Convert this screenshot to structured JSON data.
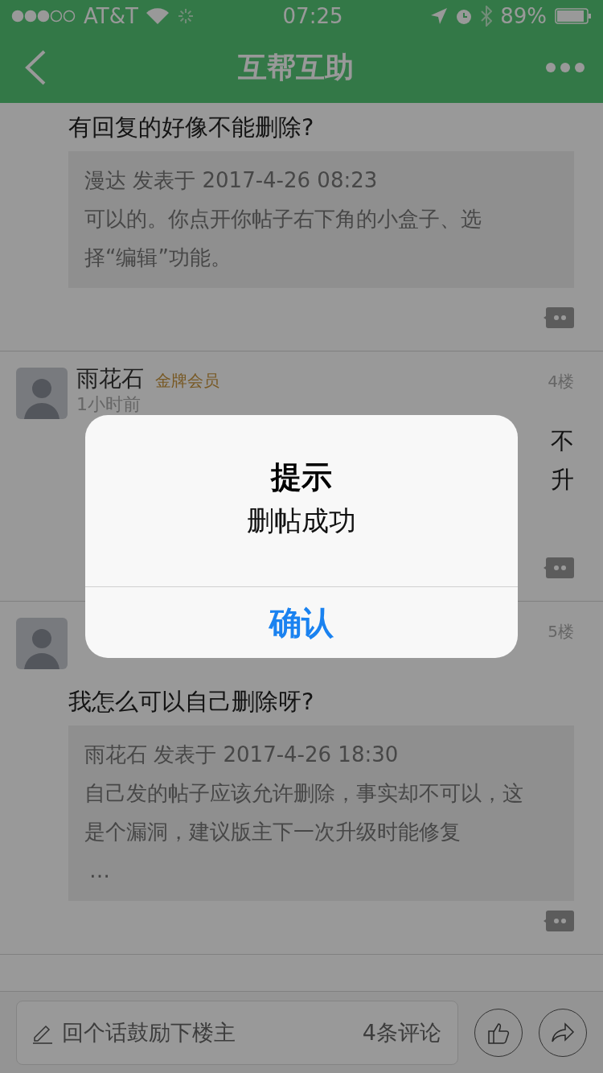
{
  "status_bar": {
    "carrier": "AT&T",
    "time": "07:25",
    "battery": "89%"
  },
  "nav": {
    "title": "互帮互助"
  },
  "posts": [
    {
      "question": "有回复的好像不能删除?",
      "quote": {
        "author_line": "漫达 发表于 2017-4-26 08:23",
        "lines": [
          "可以的。你点开你帖子右下角的小盒子、选",
          "择“编辑”功能。"
        ]
      }
    },
    {
      "author": "雨花石",
      "badge": "金牌会员",
      "time": "1小时前",
      "floor": "4楼",
      "body": [
        "不",
        "升"
      ]
    },
    {
      "floor": "5楼",
      "question": "我怎么可以自己删除呀?",
      "quote": {
        "author_line": "雨花石 发表于 2017-4-26 18:30",
        "lines": [
          "自己发的帖子应该允许删除，事实却不可以，这",
          "是个漏洞，建议版主下一次升级时能修复"
        ],
        "more": "…"
      }
    }
  ],
  "reply_bar": {
    "placeholder": "回个话鼓励下楼主",
    "comment_count": "4条评论"
  },
  "dialog": {
    "title": "提示",
    "message": "删帖成功",
    "button": "确认"
  }
}
